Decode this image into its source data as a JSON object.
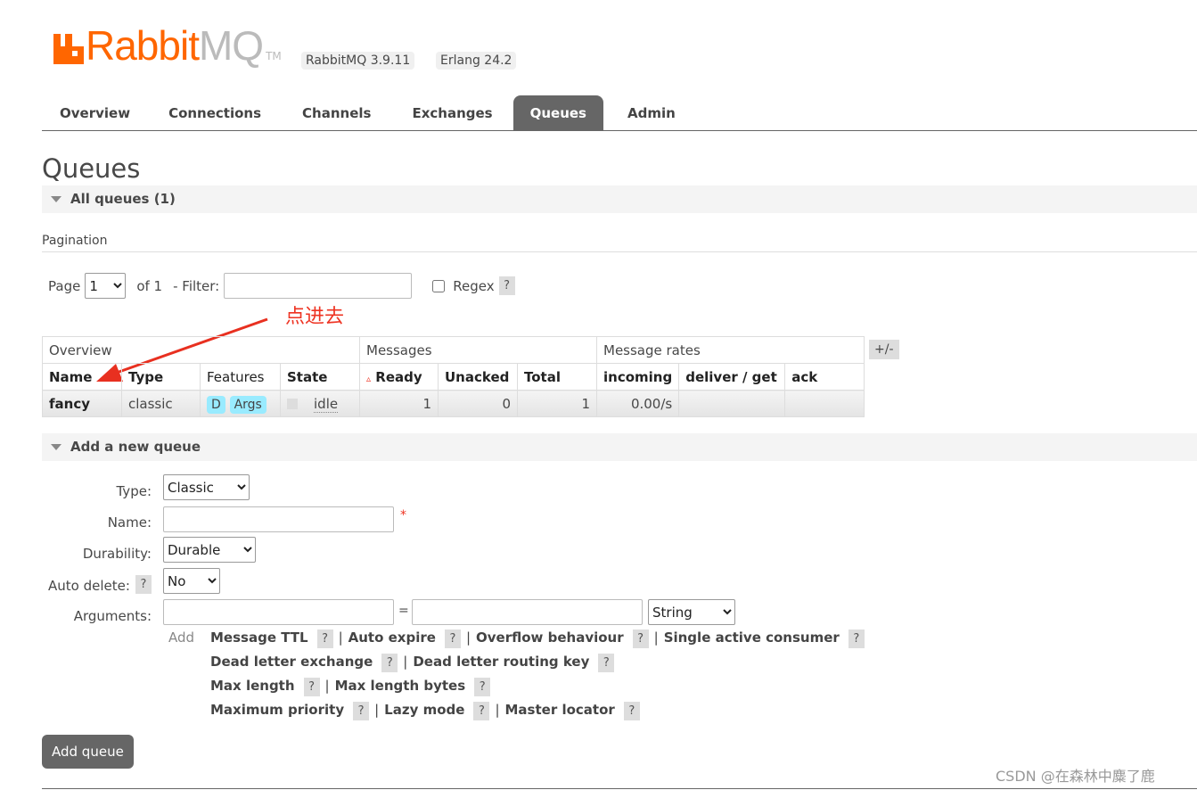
{
  "logo": {
    "text_a": "Rabbit",
    "text_b": "MQ",
    "tm": "TM"
  },
  "versions": {
    "rabbitmq": "RabbitMQ 3.9.11",
    "erlang": "Erlang 24.2"
  },
  "nav": [
    {
      "label": "Overview"
    },
    {
      "label": "Connections"
    },
    {
      "label": "Channels"
    },
    {
      "label": "Exchanges"
    },
    {
      "label": "Queues",
      "active": true
    },
    {
      "label": "Admin"
    }
  ],
  "page_title": "Queues",
  "all_queues": "All queues (1)",
  "pagination": {
    "heading": "Pagination",
    "page_label": "Page",
    "page_value": "1",
    "of": "of 1",
    "filter_label": "- Filter:",
    "filter_value": "",
    "regex_label": "Regex",
    "help": "?"
  },
  "annotation": "点进去",
  "table": {
    "groups": [
      "Overview",
      "Messages",
      "Message rates"
    ],
    "toggle": "+/-",
    "columns": [
      "Name",
      "Type",
      "Features",
      "State",
      "Ready",
      "Unacked",
      "Total",
      "incoming",
      "deliver / get",
      "ack"
    ],
    "sort_indicator": "▵",
    "rows": [
      {
        "name": "fancy",
        "type": "classic",
        "features": [
          "D",
          "Args"
        ],
        "state": "idle",
        "ready": "1",
        "unacked": "0",
        "total": "1",
        "incoming": "0.00/s",
        "deliver_get": "",
        "ack": ""
      }
    ]
  },
  "add_queue": {
    "heading": "Add a new queue",
    "type_label": "Type:",
    "type_value": "Classic",
    "name_label": "Name:",
    "name_value": "",
    "required": "*",
    "durability_label": "Durability:",
    "durability_value": "Durable",
    "auto_delete_label": "Auto delete:",
    "auto_delete_value": "No",
    "arguments_label": "Arguments:",
    "eq": "=",
    "arg_type": "String",
    "add": "Add",
    "arg_lines": [
      [
        "Message TTL",
        "Auto expire",
        "Overflow behaviour",
        "Single active consumer"
      ],
      [
        "Dead letter exchange",
        "Dead letter routing key"
      ],
      [
        "Max length",
        "Max length bytes"
      ],
      [
        "Maximum priority",
        "Lazy mode",
        "Master locator"
      ]
    ],
    "submit": "Add queue"
  },
  "watermark": "CSDN @在森林中麋了鹿",
  "colors": {
    "brand": "#ff6600",
    "nav_active": "#666666",
    "tag": "#99ebff",
    "annotation": "#e83020"
  }
}
